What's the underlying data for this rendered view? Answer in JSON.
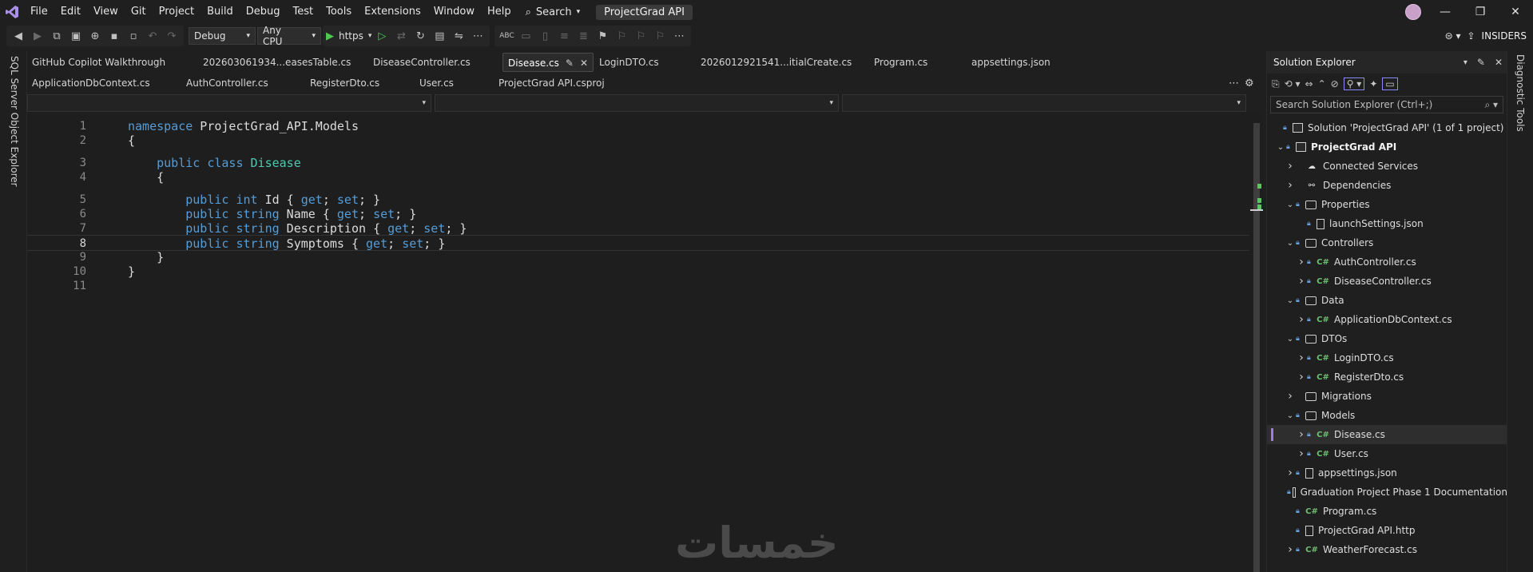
{
  "menu": {
    "items": [
      "File",
      "Edit",
      "View",
      "Git",
      "Project",
      "Build",
      "Debug",
      "Test",
      "Tools",
      "Extensions",
      "Window",
      "Help"
    ],
    "search_label": "Search",
    "project_title": "ProjectGrad API"
  },
  "toolbar": {
    "configuration": "Debug",
    "platform": "Any CPU",
    "run_profile": "https",
    "channel": "INSIDERS"
  },
  "left_panel": {
    "label": "SQL Server Object Explorer"
  },
  "right_panel": {
    "label": "Diagnostic Tools"
  },
  "tabs": {
    "row1": [
      "GitHub Copilot Walkthrough",
      "202603061934...easesTable.cs",
      "DiseaseController.cs",
      "Disease.cs",
      "LoginDTO.cs",
      "2026012921541...itialCreate.cs",
      "Program.cs",
      "appsettings.json"
    ],
    "row2": [
      "ApplicationDbContext.cs",
      "AuthController.cs",
      "RegisterDto.cs",
      "User.cs",
      "ProjectGrad API.csproj"
    ],
    "active": "Disease.cs"
  },
  "editor": {
    "current_line": 8,
    "lines": [
      {
        "n": "1",
        "tokens": [
          [
            "kw",
            "namespace"
          ],
          [
            "id",
            " ProjectGrad_API.Models"
          ]
        ]
      },
      {
        "n": "2",
        "tokens": [
          [
            "pn",
            "{"
          ]
        ]
      },
      {
        "n": "3",
        "tokens": [
          [
            "pn",
            "    "
          ],
          [
            "kw",
            "public"
          ],
          [
            "pn",
            " "
          ],
          [
            "kw",
            "class"
          ],
          [
            "pn",
            " "
          ],
          [
            "ty",
            "Disease"
          ]
        ]
      },
      {
        "n": "4",
        "tokens": [
          [
            "pn",
            "    {"
          ]
        ]
      },
      {
        "n": "5",
        "tokens": [
          [
            "pn",
            "        "
          ],
          [
            "kw",
            "public"
          ],
          [
            "pn",
            " "
          ],
          [
            "kw",
            "int"
          ],
          [
            "id",
            " Id "
          ],
          [
            "pn",
            "{ "
          ],
          [
            "kw",
            "get"
          ],
          [
            "pn",
            "; "
          ],
          [
            "kw",
            "set"
          ],
          [
            "pn",
            "; }"
          ]
        ]
      },
      {
        "n": "6",
        "tokens": [
          [
            "pn",
            "        "
          ],
          [
            "kw",
            "public"
          ],
          [
            "pn",
            " "
          ],
          [
            "kw",
            "string"
          ],
          [
            "id",
            " Name "
          ],
          [
            "pn",
            "{ "
          ],
          [
            "kw",
            "get"
          ],
          [
            "pn",
            "; "
          ],
          [
            "kw",
            "set"
          ],
          [
            "pn",
            "; }"
          ]
        ]
      },
      {
        "n": "7",
        "tokens": [
          [
            "pn",
            "        "
          ],
          [
            "kw",
            "public"
          ],
          [
            "pn",
            " "
          ],
          [
            "kw",
            "string"
          ],
          [
            "id",
            " Description "
          ],
          [
            "pn",
            "{ "
          ],
          [
            "kw",
            "get"
          ],
          [
            "pn",
            "; "
          ],
          [
            "kw",
            "set"
          ],
          [
            "pn",
            "; }"
          ]
        ]
      },
      {
        "n": "8",
        "tokens": [
          [
            "pn",
            "        "
          ],
          [
            "kw",
            "public"
          ],
          [
            "pn",
            " "
          ],
          [
            "kw",
            "string"
          ],
          [
            "id",
            " Symptoms "
          ],
          [
            "pn",
            "{ "
          ],
          [
            "kw",
            "get"
          ],
          [
            "pn",
            "; "
          ],
          [
            "kw",
            "set"
          ],
          [
            "pn",
            "; }"
          ]
        ]
      },
      {
        "n": "9",
        "tokens": [
          [
            "pn",
            "    }"
          ]
        ]
      },
      {
        "n": "10",
        "tokens": [
          [
            "pn",
            "}"
          ]
        ]
      },
      {
        "n": "11",
        "tokens": []
      }
    ]
  },
  "watermark": "خمسات",
  "solution_explorer": {
    "title": "Solution Explorer",
    "search_placeholder": "Search Solution Explorer (Ctrl+;)",
    "items": [
      {
        "label": "Solution 'ProjectGrad API' (1 of 1 project)",
        "icon": "solution-icon",
        "chevron": "",
        "lock": true,
        "bold": false
      },
      {
        "label": "ProjectGrad API",
        "icon": "project-icon",
        "chevron": "expanded",
        "lock": true,
        "bold": true
      },
      {
        "label": "Connected Services",
        "icon": "connected-services-icon",
        "chevron": "collapsed",
        "lock": false,
        "bold": false
      },
      {
        "label": "Dependencies",
        "icon": "dependencies-icon",
        "chevron": "collapsed",
        "lock": false,
        "bold": false
      },
      {
        "label": "Properties",
        "icon": "properties-folder-icon",
        "chevron": "expanded",
        "lock": true,
        "bold": false
      },
      {
        "label": "launchSettings.json",
        "icon": "json-file-icon",
        "chevron": "",
        "lock": true,
        "bold": false
      },
      {
        "label": "Controllers",
        "icon": "folder-icon",
        "chevron": "expanded",
        "lock": true,
        "bold": false
      },
      {
        "label": "AuthController.cs",
        "icon": "csharp-file-icon",
        "chevron": "collapsed",
        "lock": true,
        "bold": false
      },
      {
        "label": "DiseaseController.cs",
        "icon": "csharp-file-icon",
        "chevron": "collapsed",
        "lock": true,
        "bold": false
      },
      {
        "label": "Data",
        "icon": "folder-icon",
        "chevron": "expanded",
        "lock": true,
        "bold": false
      },
      {
        "label": "ApplicationDbContext.cs",
        "icon": "csharp-file-icon",
        "chevron": "collapsed",
        "lock": true,
        "bold": false
      },
      {
        "label": "DTOs",
        "icon": "folder-icon",
        "chevron": "expanded",
        "lock": true,
        "bold": false
      },
      {
        "label": "LoginDTO.cs",
        "icon": "csharp-file-icon",
        "chevron": "collapsed",
        "lock": true,
        "bold": false
      },
      {
        "label": "RegisterDto.cs",
        "icon": "csharp-file-icon",
        "chevron": "collapsed",
        "lock": true,
        "bold": false
      },
      {
        "label": "Migrations",
        "icon": "folder-icon",
        "chevron": "collapsed",
        "lock": false,
        "bold": false
      },
      {
        "label": "Models",
        "icon": "folder-icon",
        "chevron": "expanded",
        "lock": true,
        "bold": false
      },
      {
        "label": "Disease.cs",
        "icon": "csharp-file-icon",
        "chevron": "collapsed",
        "lock": true,
        "bold": false,
        "selected": true
      },
      {
        "label": "User.cs",
        "icon": "csharp-file-icon",
        "chevron": "collapsed",
        "lock": true,
        "bold": false
      },
      {
        "label": "appsettings.json",
        "icon": "json-file-icon",
        "chevron": "collapsed",
        "lock": true,
        "bold": false
      },
      {
        "label": "Graduation Project Phase 1 Documentation",
        "icon": "document-icon",
        "chevron": "",
        "lock": true,
        "bold": false
      },
      {
        "label": "Program.cs",
        "icon": "csharp-file-icon",
        "chevron": "",
        "lock": true,
        "bold": false
      },
      {
        "label": "ProjectGrad API.http",
        "icon": "http-file-icon",
        "chevron": "",
        "lock": true,
        "bold": false
      },
      {
        "label": "WeatherForecast.cs",
        "icon": "csharp-file-icon",
        "chevron": "collapsed",
        "lock": true,
        "bold": false
      }
    ]
  },
  "colors": {
    "keyword": "#569cd6",
    "type": "#4ec9b0",
    "accent": "#9e7ae6",
    "csharp_icon": "#6fbf6f"
  }
}
